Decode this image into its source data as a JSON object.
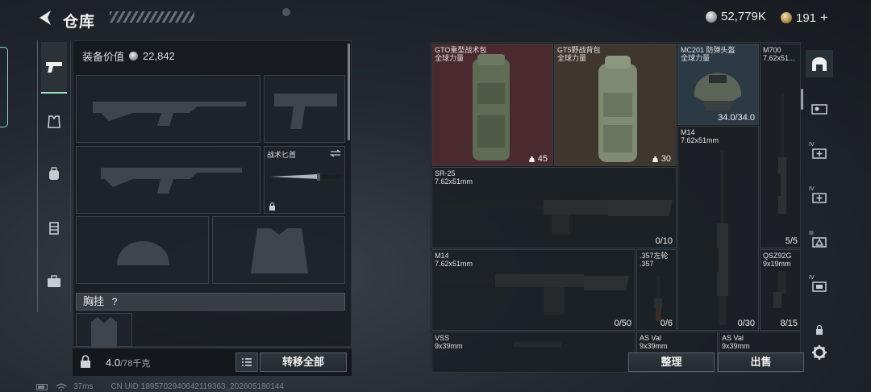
{
  "header": {
    "title": "仓库",
    "silver_balance": "52,779K",
    "gold_balance": "191",
    "gold_plus": "+"
  },
  "equipment": {
    "value_label": "装备价值",
    "value": "22,842",
    "knife_label": "战术匕首",
    "chest_label": "胸挂",
    "chest_help": "?"
  },
  "bottom_bar": {
    "weight": "4.0",
    "weight_capacity": "/78千克",
    "transfer_all": "转移全部"
  },
  "storage": {
    "items": [
      {
        "name": "GTO重型战术包",
        "sub": "全球力量",
        "count": "45"
      },
      {
        "name": "GT5野战背包",
        "sub": "全球力量",
        "count": "30"
      },
      {
        "name": "MC201 防弹头盔",
        "sub": "全球力量",
        "count": "34.0/34.0"
      },
      {
        "name": "M700",
        "sub": "7.62x51...",
        "count": "5/5"
      },
      {
        "name": "M14",
        "sub": "7.62x51mm",
        "count": "0/30"
      },
      {
        "name": "SR-25",
        "sub": "7.62x51mm",
        "count": "0/10"
      },
      {
        "name": "M14",
        "sub": "7.62x51mm",
        "count": "0/50"
      },
      {
        "name": ".357左轮",
        "sub": ".357",
        "count": "0/6"
      },
      {
        "name": "QSZ92G",
        "sub": "9x19mm",
        "count": "8/15"
      },
      {
        "name": "VSS",
        "sub": "9x39mm"
      },
      {
        "name": "AS Val",
        "sub": "9x39mm"
      },
      {
        "name": "AS Val",
        "sub": "9x39mm"
      }
    ],
    "sort_label": "整理",
    "sell_label": "出售"
  },
  "right_nav": {
    "tab_labels": [
      "IV",
      "IV",
      "III",
      "IV"
    ]
  },
  "footer": {
    "ping": "37ms",
    "uid": "CN UID 1895702940642119363_202605180144"
  },
  "colors": {
    "accent": "#9be3c8",
    "red_cell": "#4a2a2e",
    "brown_cell": "#3f362e",
    "blue_cell": "#2c3a46"
  }
}
